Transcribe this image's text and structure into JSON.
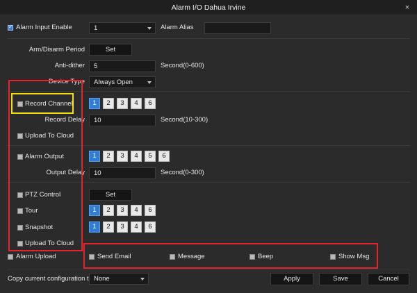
{
  "window": {
    "title": "Alarm I/O Dahua Irvine",
    "close_glyph": "×"
  },
  "alarm_input": {
    "label": "Alarm Input Enable",
    "value": "1",
    "alias_label": "Alarm Alias",
    "alias_value": ""
  },
  "arm_period": {
    "label": "Arm/Disarm Period",
    "button": "Set"
  },
  "anti_dither": {
    "label": "Anti-dither",
    "value": "5",
    "unit": "Second(0-600)"
  },
  "device_type": {
    "label": "Device Type",
    "value": "Always Open"
  },
  "record_channel": {
    "label": "Record Channel",
    "channels": [
      "1",
      "2",
      "3",
      "4",
      "6"
    ],
    "selected": [
      "1"
    ]
  },
  "record_delay": {
    "label": "Record Delay",
    "value": "10",
    "unit": "Second(10-300)"
  },
  "upload_cloud_1": {
    "label": "Upload To Cloud"
  },
  "alarm_output": {
    "label": "Alarm Output",
    "channels": [
      "1",
      "2",
      "3",
      "4",
      "5",
      "6"
    ],
    "selected": [
      "1"
    ]
  },
  "output_delay": {
    "label": "Output Delay",
    "value": "10",
    "unit": "Second(0-300)"
  },
  "ptz_control": {
    "label": "PTZ Control",
    "button": "Set"
  },
  "tour": {
    "label": "Tour",
    "channels": [
      "1",
      "2",
      "3",
      "4",
      "6"
    ],
    "selected": [
      "1"
    ]
  },
  "snapshot": {
    "label": "Snapshot",
    "channels": [
      "1",
      "2",
      "3",
      "4",
      "6"
    ],
    "selected": [
      "1"
    ]
  },
  "upload_cloud_2": {
    "label": "Upload To Cloud"
  },
  "alarm_upload": {
    "label": "Alarm Upload"
  },
  "notify": {
    "send_email": "Send Email",
    "message": "Message",
    "beep": "Beep",
    "show_msg": "Show Msg"
  },
  "footer": {
    "copy_label": "Copy current configuration to",
    "copy_value": "None",
    "apply": "Apply",
    "save": "Save",
    "cancel": "Cancel"
  },
  "colors": {
    "accent": "#2f7dd6",
    "highlight_red": "#e5232b",
    "highlight_yellow": "#f4e10a"
  }
}
